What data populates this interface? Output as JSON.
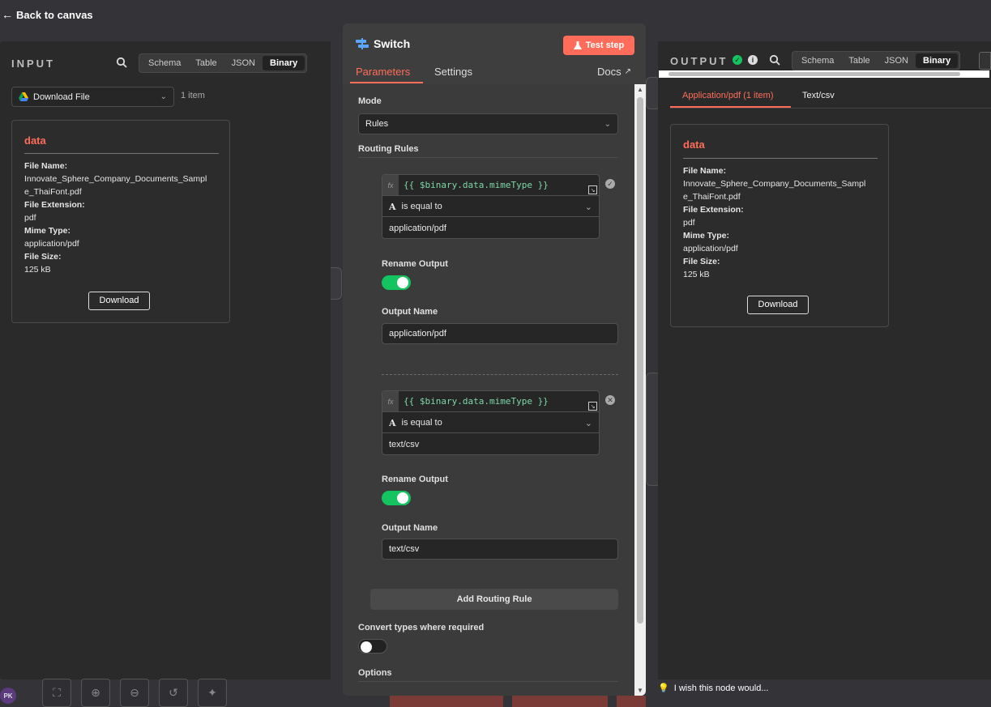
{
  "nav": {
    "back_label": "Back to canvas"
  },
  "input": {
    "title": "INPUT",
    "view_tabs": [
      "Schema",
      "Table",
      "JSON",
      "Binary"
    ],
    "active_tab": "Binary",
    "source_node": "Download File",
    "item_count": "1 item",
    "card": {
      "title": "data",
      "file_name_label": "File Name:",
      "file_name_line1": "Innovate_Sphere_Company_Documents_Sampl",
      "file_name_line2": "e_ThaiFont.pdf",
      "file_ext_label": "File Extension:",
      "file_ext": "pdf",
      "mime_label": "Mime Type:",
      "mime": "application/pdf",
      "size_label": "File Size:",
      "size": "125 kB",
      "download_label": "Download"
    }
  },
  "node": {
    "title": "Switch",
    "test_step_label": "Test step",
    "tabs": {
      "parameters": "Parameters",
      "settings": "Settings",
      "docs": "Docs"
    },
    "mode_label": "Mode",
    "mode_value": "Rules",
    "routing_rules_label": "Routing Rules",
    "rules": [
      {
        "expression": "{{ $binary.data.mimeType }}",
        "operator": "is equal to",
        "value": "application/pdf",
        "rename_output_label": "Rename Output",
        "rename_output": true,
        "output_name_label": "Output Name",
        "output_name": "application/pdf"
      },
      {
        "expression": "{{ $binary.data.mimeType }}",
        "operator": "is equal to",
        "value": "text/csv",
        "rename_output_label": "Rename Output",
        "rename_output": true,
        "output_name_label": "Output Name",
        "output_name": "text/csv"
      }
    ],
    "add_rule_label": "Add Routing Rule",
    "convert_types_label": "Convert types where required",
    "convert_types": false,
    "options_label": "Options",
    "fx_label": "fx"
  },
  "output": {
    "title": "OUTPUT",
    "view_tabs": [
      "Schema",
      "Table",
      "JSON",
      "Binary"
    ],
    "active_tab": "Binary",
    "branch_tabs": [
      "Application/pdf (1 item)",
      "Text/csv"
    ],
    "card": {
      "title": "data",
      "file_name_label": "File Name:",
      "file_name_line1": "Innovate_Sphere_Company_Documents_Sampl",
      "file_name_line2": "e_ThaiFont.pdf",
      "file_ext_label": "File Extension:",
      "file_ext": "pdf",
      "mime_label": "Mime Type:",
      "mime": "application/pdf",
      "size_label": "File Size:",
      "size": "125 kB",
      "download_label": "Download"
    },
    "feedback_label": "I wish this node would..."
  },
  "user": {
    "initials": "PK"
  },
  "colors": {
    "accent": "#ff6d5a",
    "toggle_on": "#13c461",
    "expression": "#7ed7a7"
  }
}
